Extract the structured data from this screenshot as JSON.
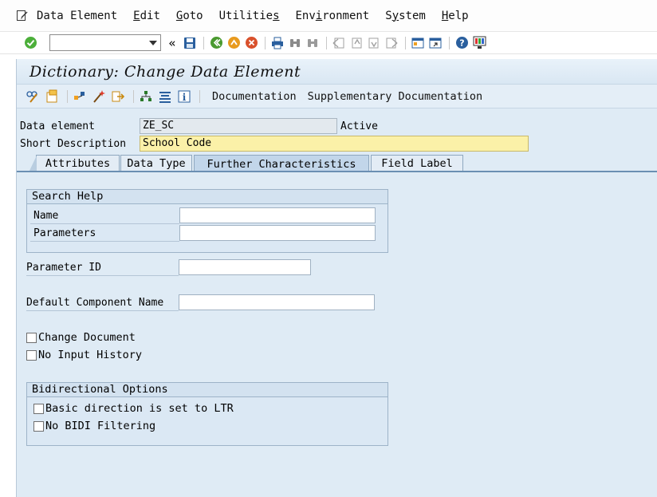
{
  "menubar": {
    "items": [
      {
        "pre": "",
        "acc": "",
        "post": "Data Element"
      },
      {
        "pre": "",
        "acc": "E",
        "post": "dit"
      },
      {
        "pre": "",
        "acc": "G",
        "post": "oto"
      },
      {
        "pre": "Utilitie",
        "acc": "s",
        "post": ""
      },
      {
        "pre": "Env",
        "acc": "i",
        "post": "ronment"
      },
      {
        "pre": "S",
        "acc": "y",
        "post": "stem"
      },
      {
        "pre": "",
        "acc": "H",
        "post": "elp"
      }
    ]
  },
  "stdbar": {
    "command_value": "",
    "chevron": "«"
  },
  "screen": {
    "title": "Dictionary: Change Data Element"
  },
  "apptoolbar": {
    "documentation": "Documentation",
    "supplementary": "Supplementary Documentation"
  },
  "header": {
    "data_element_label": "Data element",
    "data_element_value": "ZE_SC",
    "status": "Active",
    "short_desc_label": "Short Description",
    "short_desc_value": "School Code"
  },
  "tabs": [
    "Attributes",
    "Data Type",
    "Further Characteristics",
    "Field Label"
  ],
  "active_tab": "Further Characteristics",
  "search_help": {
    "title": "Search Help",
    "name_label": "Name",
    "name_value": "",
    "params_label": "Parameters",
    "params_value": ""
  },
  "parameter_id": {
    "label": "Parameter ID",
    "value": ""
  },
  "default_component": {
    "label": "Default Component Name",
    "value": ""
  },
  "checks": {
    "change_document": {
      "label": "Change Document",
      "checked": false
    },
    "no_input_history": {
      "label": "No Input History",
      "checked": false
    }
  },
  "bidi": {
    "title": "Bidirectional Options",
    "ltr": {
      "label": "Basic direction is set to LTR",
      "checked": false
    },
    "no_filter": {
      "label": "No BIDI Filtering",
      "checked": false
    }
  },
  "colors": {
    "background": "#dfebf5",
    "required_field": "#fbf1a8",
    "tab_active": "#c2d6ea"
  }
}
